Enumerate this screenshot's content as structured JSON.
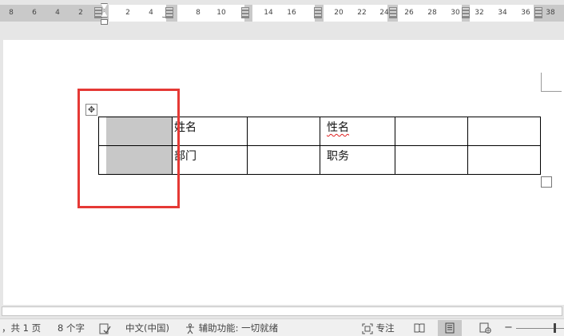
{
  "ruler": {
    "labels_left": [
      "8",
      "6",
      "4",
      "2"
    ],
    "labels_right": [
      "2",
      "4",
      "8",
      "10",
      "14",
      "16",
      "20",
      "22",
      "24",
      "26",
      "28",
      "30",
      "32",
      "34",
      "36",
      "38"
    ]
  },
  "table": {
    "rows": [
      [
        "",
        "姓名",
        "",
        "性名",
        "",
        ""
      ],
      [
        "",
        "部门",
        "",
        "职务",
        "",
        ""
      ]
    ]
  },
  "statusbar": {
    "pages": "，共 1 页",
    "words": "8 个字",
    "language": "中文(中国)",
    "accessibility": "辅助功能: 一切就绪",
    "focus": "专注",
    "zoom_minus": "−"
  },
  "icons": {
    "move": "move-icon",
    "proofing": "proofing-icon",
    "accessibility": "accessibility-icon",
    "focus": "focus-icon",
    "read_mode": "read-mode-icon",
    "print_layout": "print-layout-icon",
    "web_layout": "web-layout-icon"
  },
  "colors": {
    "highlight": "#e53935",
    "cell_shading": "#c8c8c8",
    "spell_error": "#e02020"
  }
}
